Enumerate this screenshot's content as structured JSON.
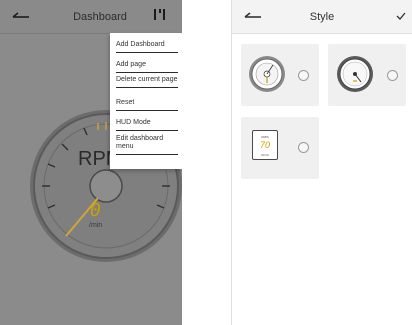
{
  "left_screen": {
    "title": "Dashboard",
    "gauge": {
      "label": "RPM",
      "value": "0",
      "unit": "/min"
    },
    "menu": {
      "items": [
        {
          "label": "Add Dashboard"
        },
        {
          "label": "Add page"
        },
        {
          "label": "Delete current page"
        },
        {
          "label": "Reset"
        },
        {
          "label": "HUD Mode"
        },
        {
          "label": "Edit dashboard menu"
        }
      ]
    }
  },
  "right_screen": {
    "title": "Style",
    "styles": [
      {
        "name": "analog-style-1",
        "selected": false
      },
      {
        "name": "analog-style-2",
        "selected": false
      },
      {
        "name": "digital-style",
        "selected": false
      }
    ],
    "digital_thumb": {
      "label": "KM/h",
      "value": "70",
      "unit": "Km/h"
    }
  },
  "colors": {
    "accent": "#c8a200",
    "overlay_gray": "#8b8b8b"
  }
}
